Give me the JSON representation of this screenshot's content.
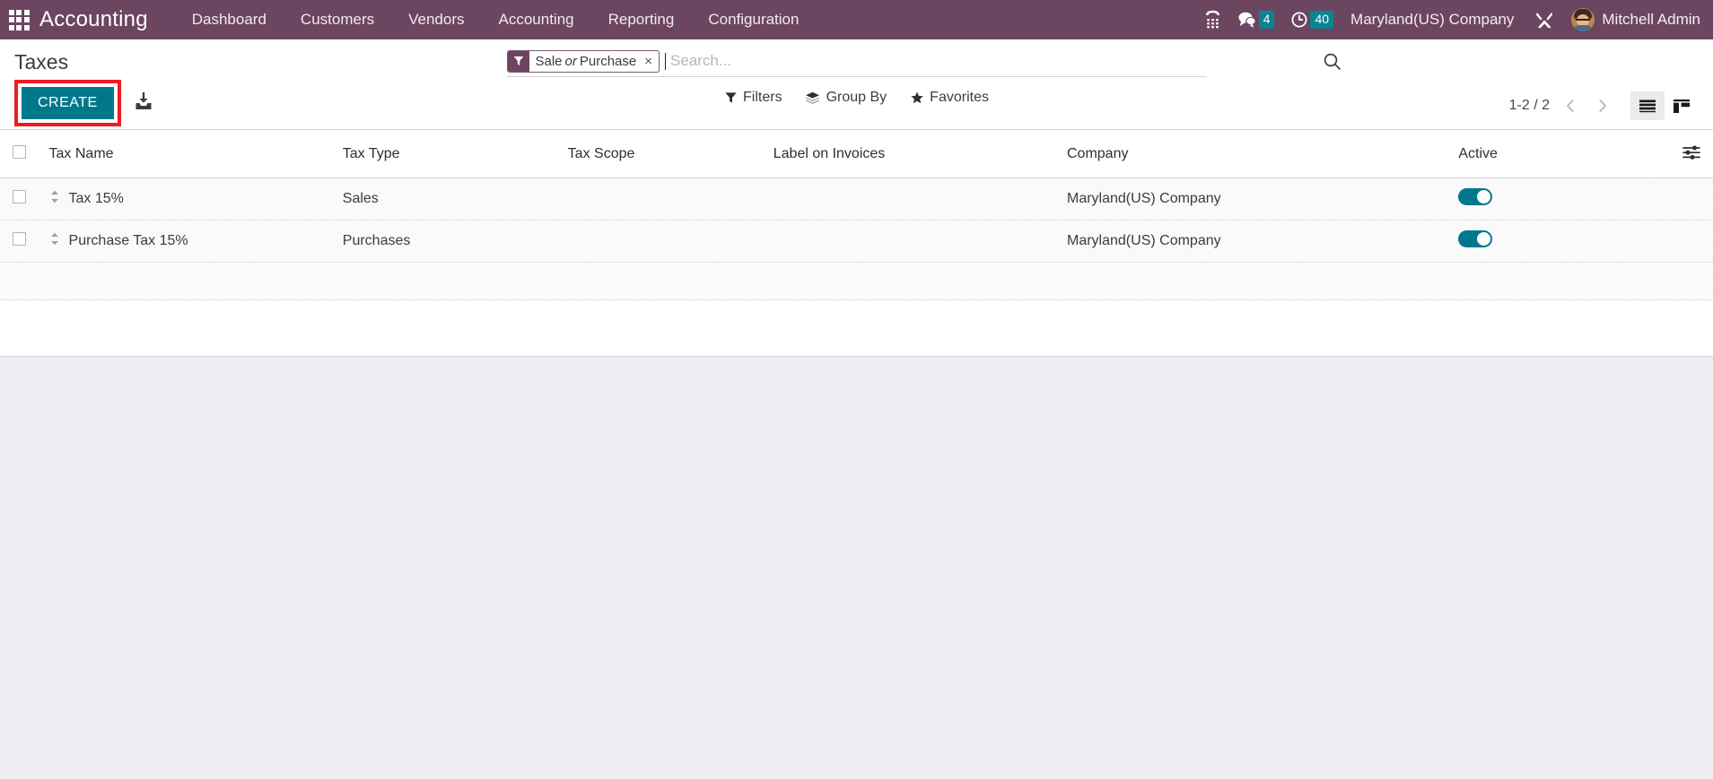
{
  "navbar": {
    "apps_icon": "apps-grid-icon",
    "brand": "Accounting",
    "menu": [
      {
        "label": "Dashboard"
      },
      {
        "label": "Customers"
      },
      {
        "label": "Vendors"
      },
      {
        "label": "Accounting"
      },
      {
        "label": "Reporting"
      },
      {
        "label": "Configuration"
      }
    ],
    "icons": {
      "voip": "phone-dialpad-icon",
      "messages": "chat-bubble-icon",
      "activities": "clock-icon",
      "debug": "wrench-tools-icon",
      "avatar": "user-avatar"
    },
    "messages_count": "4",
    "activities_count": "40",
    "company": "Maryland(US) Company",
    "user": "Mitchell Admin",
    "bg_color": "#6c4560",
    "badge_color": "#0c8391"
  },
  "control_panel": {
    "title": "Taxes",
    "create_label": "CREATE",
    "create_color": "#00788c",
    "highlight_color": "#ed1c24",
    "import_icon": "import-download-icon",
    "filters_label": "Filters",
    "group_by_label": "Group By",
    "favorites_label": "Favorites",
    "pager": "1-2 / 2",
    "views": [
      {
        "name": "list",
        "icon": "list-view-icon",
        "active": true
      },
      {
        "name": "kanban",
        "icon": "kanban-view-icon",
        "active": false
      }
    ]
  },
  "search": {
    "placeholder": "Search...",
    "value": "",
    "facet": {
      "icon": "filter-funnel-icon",
      "part1": "Sale",
      "joiner": "or",
      "part2": "Purchase",
      "remove": "×"
    },
    "search_icon": "search-magnifier-icon"
  },
  "table": {
    "columns": [
      {
        "key": "select",
        "label": ""
      },
      {
        "key": "tax_name",
        "label": "Tax Name"
      },
      {
        "key": "tax_type",
        "label": "Tax Type"
      },
      {
        "key": "tax_scope",
        "label": "Tax Scope"
      },
      {
        "key": "label_on_invoices",
        "label": "Label on Invoices"
      },
      {
        "key": "company",
        "label": "Company"
      },
      {
        "key": "active",
        "label": "Active"
      },
      {
        "key": "options",
        "label": ""
      }
    ],
    "optional_columns_icon": "column-options-icon",
    "rows": [
      {
        "tax_name": "Tax 15%",
        "tax_type": "Sales",
        "tax_scope": "",
        "label_on_invoices": "",
        "company": "Maryland(US) Company",
        "active": true
      },
      {
        "tax_name": "Purchase Tax 15%",
        "tax_type": "Purchases",
        "tax_scope": "",
        "label_on_invoices": "",
        "company": "Maryland(US) Company",
        "active": true
      }
    ]
  }
}
